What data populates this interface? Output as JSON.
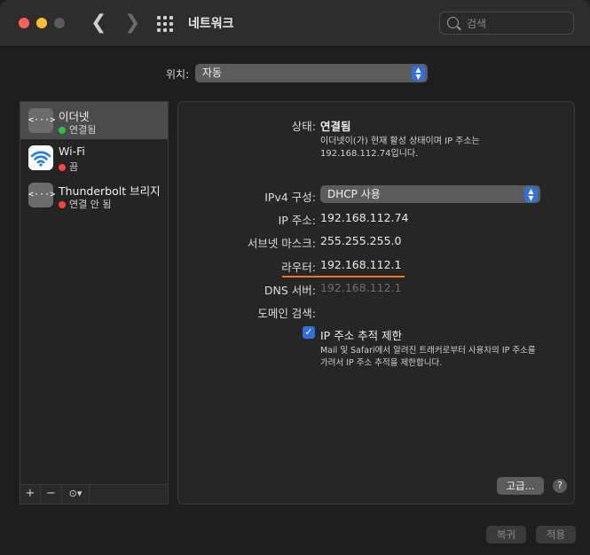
{
  "window": {
    "title": "네트워크"
  },
  "search": {
    "placeholder": "검색"
  },
  "location": {
    "label": "위치:",
    "value": "자동"
  },
  "services": [
    {
      "name": "이더넷",
      "status": "연결됨",
      "status_color": "#30c048",
      "icon": "ethernet-icon"
    },
    {
      "name": "Wi-Fi",
      "status": "끔",
      "status_color": "#ff453a",
      "icon": "wifi-icon"
    },
    {
      "name": "Thunderbolt 브리지",
      "status": "연결 안 됨",
      "status_color": "#ff453a",
      "icon": "ethernet-icon"
    }
  ],
  "sidebar_buttons": {
    "add": "+",
    "remove": "−",
    "action": "⊙▾"
  },
  "detail": {
    "status_label": "상태:",
    "status_value": "연결됨",
    "status_desc_1": "이더넷이(가) 현재 활성 상태이며 IP 주소는",
    "status_desc_2": "192.168.112.74입니다.",
    "ipv4_label": "IPv4 구성:",
    "ipv4_value": "DHCP 사용",
    "ip_label": "IP 주소:",
    "ip_value": "192.168.112.74",
    "subnet_label": "서브넷 마스크:",
    "subnet_value": "255.255.255.0",
    "router_label": "라우터:",
    "router_value": "192.168.112.1",
    "dns_label": "DNS 서버:",
    "dns_value": "192.168.112.1",
    "domain_label": "도메인 검색:",
    "limit_tracking_label": "IP 주소 추적 제한",
    "limit_tracking_checked": true,
    "limit_desc_1": "Mail 및 Safari에서 알려진 트래커로부터 사용자의 IP 주소를",
    "limit_desc_2": "가려서 IP 주소 추적을 제한합니다.",
    "advanced_button": "고급...",
    "help_button": "?"
  },
  "footer": {
    "revert_button": "복귀",
    "apply_button": "적용"
  },
  "colors": {
    "accent": "#2f6fe0",
    "highlight_underline": "#e8772a"
  }
}
